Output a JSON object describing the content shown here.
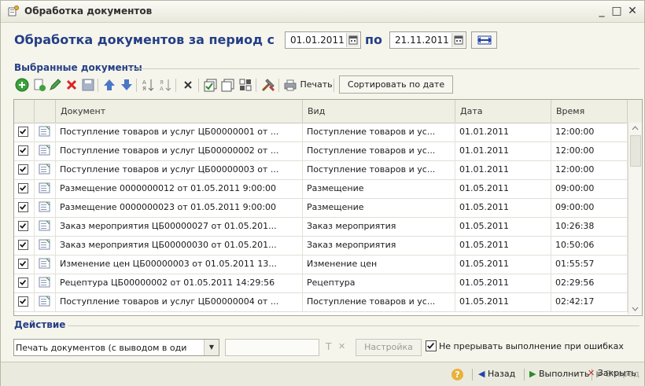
{
  "window": {
    "title": "Обработка документов",
    "minimize": "_",
    "maximize": "□",
    "close": "✕"
  },
  "period": {
    "label": "Обработка документов за период с",
    "from": "01.01.2011",
    "to_label": "по",
    "to": "21.11.2011"
  },
  "selected": {
    "group_title": "Выбранные документы"
  },
  "toolbar": {
    "print_label": "Печать",
    "sort_label": "Сортировать по дате"
  },
  "table": {
    "columns": [
      "Документ",
      "Вид",
      "Дата",
      "Время"
    ],
    "rows": [
      {
        "doc": "Поступление товаров и услуг ЦБ00000001 от ...",
        "kind": "Поступление товаров и ус...",
        "date": "01.01.2011",
        "time": "12:00:00",
        "checked": true
      },
      {
        "doc": "Поступление товаров и услуг ЦБ00000002 от ...",
        "kind": "Поступление товаров и ус...",
        "date": "01.01.2011",
        "time": "12:00:00",
        "checked": true
      },
      {
        "doc": "Поступление товаров и услуг ЦБ00000003 от ...",
        "kind": "Поступление товаров и ус...",
        "date": "01.01.2011",
        "time": "12:00:00",
        "checked": true
      },
      {
        "doc": "Размещение 0000000012 от 01.05.2011 9:00:00",
        "kind": "Размещение",
        "date": "01.05.2011",
        "time": "09:00:00",
        "checked": true
      },
      {
        "doc": "Размещение 0000000023 от 01.05.2011 9:00:00",
        "kind": "Размещение",
        "date": "01.05.2011",
        "time": "09:00:00",
        "checked": true
      },
      {
        "doc": "Заказ мероприятия ЦБ00000027 от 01.05.201...",
        "kind": "Заказ мероприятия",
        "date": "01.05.2011",
        "time": "10:26:38",
        "checked": true
      },
      {
        "doc": "Заказ мероприятия ЦБ00000030 от 01.05.201...",
        "kind": "Заказ мероприятия",
        "date": "01.05.2011",
        "time": "10:50:06",
        "checked": true
      },
      {
        "doc": "Изменение цен ЦБ00000003 от 01.05.2011 13...",
        "kind": "Изменение цен",
        "date": "01.05.2011",
        "time": "01:55:57",
        "checked": true
      },
      {
        "doc": "Рецептура ЦБ00000002 от 01.05.2011 14:29:56",
        "kind": "Рецептура",
        "date": "01.05.2011",
        "time": "02:29:56",
        "checked": true
      },
      {
        "doc": "Поступление товаров и услуг ЦБ00000004 от ...",
        "kind": "Поступление товаров и ус...",
        "date": "01.05.2011",
        "time": "02:42:17",
        "checked": true
      }
    ]
  },
  "action": {
    "group_title": "Действие",
    "value": "Печать документов (с выводом в оди",
    "clear_t": "T",
    "clear_x": "✕",
    "settings_label": "Настройка",
    "continue_label": "Не прерывать выполнение при ошибках",
    "continue_checked": true
  },
  "footer": {
    "help": "?",
    "back": "Назад",
    "run": "Выполнить",
    "forward": "Вперед",
    "close": "Закрыть"
  },
  "colors": {
    "accent": "#243f86",
    "window_bg": "#f6f5ec",
    "header_bg": "#f0efe4"
  }
}
